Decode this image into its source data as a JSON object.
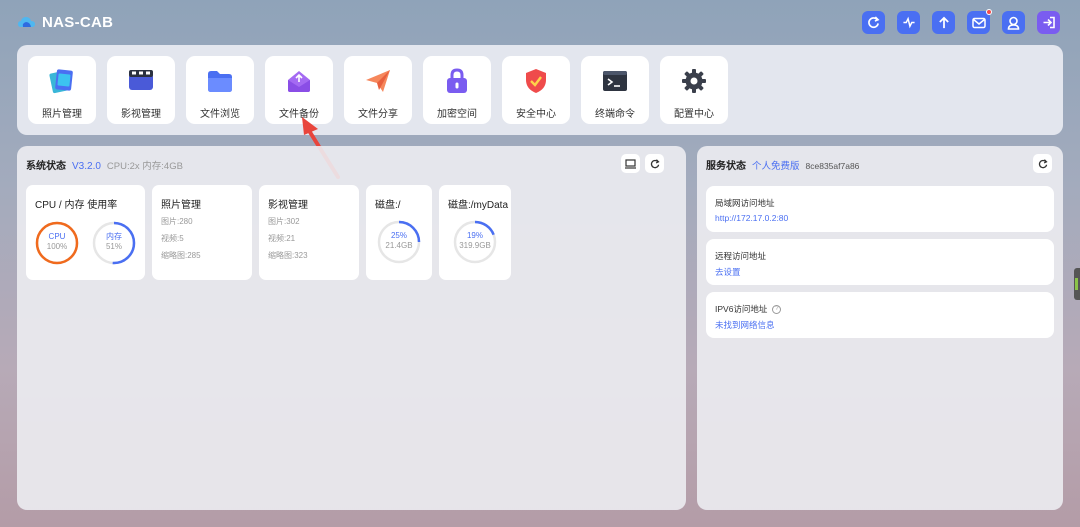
{
  "header": {
    "brand": "NAS-CAB",
    "icons": [
      "refresh-icon",
      "activity-icon",
      "upload-icon",
      "mail-icon",
      "user-icon",
      "logout-icon"
    ]
  },
  "apps": [
    {
      "label": "照片管理",
      "icon": "photos-icon"
    },
    {
      "label": "影视管理",
      "icon": "video-icon"
    },
    {
      "label": "文件浏览",
      "icon": "folder-icon"
    },
    {
      "label": "文件备份",
      "icon": "backup-icon"
    },
    {
      "label": "文件分享",
      "icon": "share-icon"
    },
    {
      "label": "加密空间",
      "icon": "lock-icon"
    },
    {
      "label": "安全中心",
      "icon": "shield-icon"
    },
    {
      "label": "终端命令",
      "icon": "terminal-icon"
    },
    {
      "label": "配置中心",
      "icon": "gear-icon"
    }
  ],
  "system": {
    "title": "系统状态",
    "version": "V3.2.0",
    "meta": "CPU:2x 内存:4GB",
    "cpu_card": {
      "title": "CPU / 内存 使用率",
      "cpu_label": "CPU",
      "cpu_value": "100%",
      "cpu_fraction": 1.0,
      "mem_label": "内存",
      "mem_value": "51%",
      "mem_fraction": 0.51
    },
    "photo_card": {
      "title": "照片管理",
      "lines": [
        "图片:280",
        "视频:5",
        "缩略图:285"
      ]
    },
    "video_card": {
      "title": "影视管理",
      "lines": [
        "图片:302",
        "视频:21",
        "缩略图:323"
      ]
    },
    "disk1": {
      "title": "磁盘:/",
      "pct": "25%",
      "size": "21.4GB",
      "fraction": 0.25
    },
    "disk2": {
      "title": "磁盘:/myData",
      "pct": "19%",
      "size": "319.9GB",
      "fraction": 0.19
    }
  },
  "service": {
    "title": "服务状态",
    "tier": "个人免费版",
    "id": "8ce835af7a86",
    "lan": {
      "title": "局域网访问地址",
      "value": "http://172.17.0.2:80"
    },
    "remote": {
      "title": "远程访问地址",
      "value": "去设置"
    },
    "ipv6": {
      "title": "IPV6访问地址",
      "help": "?",
      "value": "未找到网络信息"
    }
  },
  "colors": {
    "accent": "#4a6ff2",
    "cpu_ring": "#f06a1d",
    "arrow": "#e8453c"
  }
}
